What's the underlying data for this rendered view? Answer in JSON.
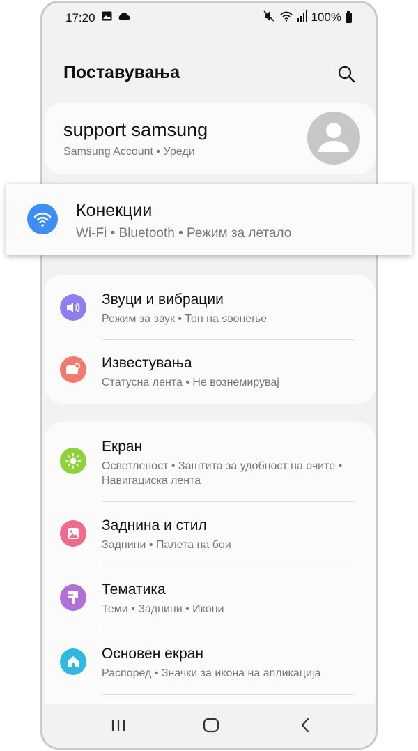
{
  "status_bar": {
    "time": "17:20",
    "battery": "100%",
    "icons": [
      "image-icon",
      "cloud-icon",
      "mute-icon",
      "wifi-icon",
      "signal-icon",
      "battery-icon"
    ]
  },
  "header": {
    "title": "Поставувања",
    "search_icon": "search-icon"
  },
  "account": {
    "name": "support samsung",
    "subtitle": "Samsung Account  •  Уреди",
    "avatar_icon": "person-icon"
  },
  "highlighted": {
    "title": "Конекции",
    "subtitle": "Wi-Fi  •  Bluetooth  •  Режим за летало",
    "icon": "wifi-icon",
    "color": "#3d8ff5"
  },
  "group1": [
    {
      "title": "Звуци и вибрации",
      "subtitle": "Режим за звук  •  Тон на ѕвонење",
      "icon": "speaker-icon",
      "color": "#8d7ff0"
    },
    {
      "title": "Известувања",
      "subtitle": "Статусна лента  •  Не вознемирувај",
      "icon": "notification-icon",
      "color": "#f27a6e"
    }
  ],
  "group2": [
    {
      "title": "Екран",
      "subtitle": "Осветленост  •  Заштита за удобност на очите  •  Навигациска лента",
      "icon": "sun-icon",
      "color": "#8fd13a"
    },
    {
      "title": "Заднина и стил",
      "subtitle": "Заднини  •  Палета на бои",
      "icon": "picture-icon",
      "color": "#ef6b8e"
    },
    {
      "title": "Тематика",
      "subtitle": "Теми  •  Заднини  •  Икони",
      "icon": "brush-icon",
      "color": "#b36fd8"
    },
    {
      "title": "Основен екран",
      "subtitle": "Распоред  •  Значки за икона на апликација",
      "icon": "home-icon",
      "color": "#30b9e0"
    }
  ],
  "nav": {
    "recents_icon": "recents-icon",
    "home_icon": "home-button-icon",
    "back_icon": "back-icon"
  }
}
